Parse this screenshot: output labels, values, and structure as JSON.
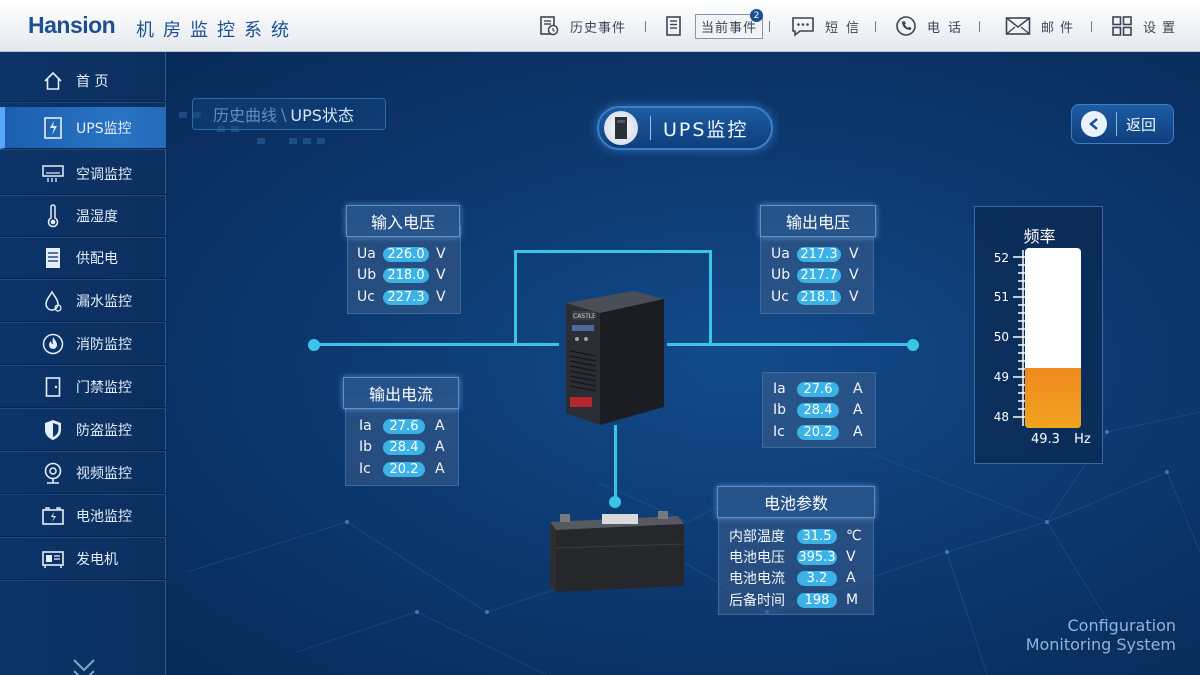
{
  "brand": {
    "name_en": "Hansion",
    "name_cn": "机房监控系统"
  },
  "header_nav": [
    {
      "label": "历史事件",
      "icon": "history-icon"
    },
    {
      "label": "当前事件",
      "icon": "current-events-icon",
      "badge": "2"
    },
    {
      "label": "短信",
      "icon": "sms-icon"
    },
    {
      "label": "电话",
      "icon": "phone-icon"
    },
    {
      "label": "邮件",
      "icon": "mail-icon"
    },
    {
      "label": "设置",
      "icon": "settings-icon"
    }
  ],
  "sidebar": {
    "items": [
      {
        "label": "首 页",
        "icon": "home-icon"
      },
      {
        "label": "UPS监控",
        "icon": "ups-icon",
        "active": true
      },
      {
        "label": "空调监控",
        "icon": "air-conditioner-icon"
      },
      {
        "label": "温湿度",
        "icon": "thermometer-icon"
      },
      {
        "label": "供配电",
        "icon": "power-distribution-icon"
      },
      {
        "label": "漏水监控",
        "icon": "water-leak-icon"
      },
      {
        "label": "消防监控",
        "icon": "fire-icon"
      },
      {
        "label": "门禁监控",
        "icon": "door-icon"
      },
      {
        "label": "防盗监控",
        "icon": "shield-icon"
      },
      {
        "label": "视频监控",
        "icon": "camera-icon"
      },
      {
        "label": "电池监控",
        "icon": "battery-icon"
      },
      {
        "label": "发电机",
        "icon": "generator-icon"
      }
    ]
  },
  "breadcrumb": {
    "parent": "历史曲线",
    "separator": "\\",
    "current": "UPS状态"
  },
  "page_title": "UPS监控",
  "back_label": "返回",
  "input_voltage": {
    "title": "输入电压",
    "rows": [
      {
        "label": "Ua",
        "value": "226.0",
        "unit": "V"
      },
      {
        "label": "Ub",
        "value": "218.0",
        "unit": "V"
      },
      {
        "label": "Uc",
        "value": "227.3",
        "unit": "V"
      }
    ]
  },
  "output_voltage": {
    "title": "输出电压",
    "rows": [
      {
        "label": "Ua",
        "value": "217.3",
        "unit": "V"
      },
      {
        "label": "Ub",
        "value": "217.7",
        "unit": "V"
      },
      {
        "label": "Uc",
        "value": "218.1",
        "unit": "V"
      }
    ]
  },
  "output_current": {
    "title": "输出电流",
    "rows": [
      {
        "label": "Ia",
        "value": "27.6",
        "unit": "A"
      },
      {
        "label": "Ib",
        "value": "28.4",
        "unit": "A"
      },
      {
        "label": "Ic",
        "value": "20.2",
        "unit": "A"
      }
    ]
  },
  "right_current": {
    "rows": [
      {
        "label": "Ia",
        "value": "27.6",
        "unit": "A"
      },
      {
        "label": "Ib",
        "value": "28.4",
        "unit": "A"
      },
      {
        "label": "Ic",
        "value": "20.2",
        "unit": "A"
      }
    ]
  },
  "battery": {
    "title": "电池参数",
    "rows": [
      {
        "label": "内部温度",
        "value": "31.5",
        "unit": "℃"
      },
      {
        "label": "电池电压",
        "value": "395.3",
        "unit": "V"
      },
      {
        "label": "电池电流",
        "value": "3.2",
        "unit": "A"
      },
      {
        "label": "后备时间",
        "value": "198",
        "unit": "M"
      }
    ]
  },
  "frequency": {
    "title": "频率",
    "ticks": [
      "52",
      "51",
      "50",
      "49",
      "48"
    ],
    "min": 47.8,
    "max": 52.3,
    "value": "49.3",
    "unit": "Hz"
  },
  "ups_brand": "CASTLE",
  "watermark": [
    "Configuration",
    "Monitoring System"
  ],
  "colors": {
    "accent": "#39c4e8",
    "pill": "#3bb3e6",
    "gauge": "#f0891e",
    "brand": "#1d4f91"
  }
}
